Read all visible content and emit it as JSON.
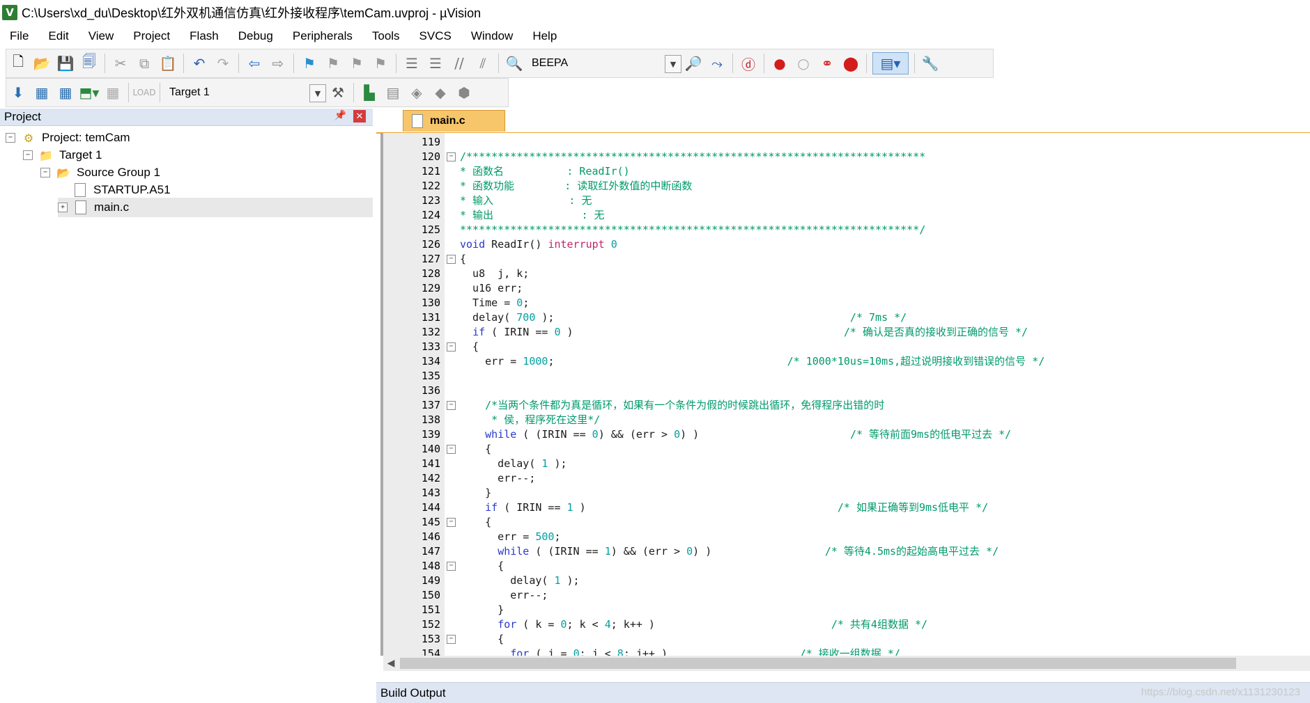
{
  "window": {
    "title": "C:\\Users\\xd_du\\Desktop\\红外双机通信仿真\\红外接收程序\\temCam.uvproj - µVision",
    "app_icon_letter": "V"
  },
  "menu": [
    "File",
    "Edit",
    "View",
    "Project",
    "Flash",
    "Debug",
    "Peripherals",
    "Tools",
    "SVCS",
    "Window",
    "Help"
  ],
  "toolbar": {
    "find_combo_value": "BEEPA",
    "target_combo_value": "Target 1"
  },
  "project_panel": {
    "title": "Project",
    "tree": {
      "project": "Project: temCam",
      "target": "Target 1",
      "group": "Source Group 1",
      "files": [
        "STARTUP.A51",
        "main.c"
      ]
    }
  },
  "editor": {
    "active_tab": "main.c",
    "lines": [
      {
        "n": "119",
        "fold": "",
        "segs": []
      },
      {
        "n": "120",
        "fold": "⊟",
        "segs": [
          {
            "t": "/*************************************************************************",
            "c": "c-comment"
          }
        ]
      },
      {
        "n": "121",
        "fold": "",
        "segs": [
          {
            "t": "* 函数名          : ReadIr()",
            "c": "c-comment"
          }
        ]
      },
      {
        "n": "122",
        "fold": "",
        "segs": [
          {
            "t": "* 函数功能        : 读取红外数值的中断函数",
            "c": "c-comment"
          }
        ]
      },
      {
        "n": "123",
        "fold": "",
        "segs": [
          {
            "t": "* 输入            : 无",
            "c": "c-comment"
          }
        ]
      },
      {
        "n": "124",
        "fold": "",
        "segs": [
          {
            "t": "* 输出              : 无",
            "c": "c-comment"
          }
        ]
      },
      {
        "n": "125",
        "fold": "",
        "segs": [
          {
            "t": "*************************************************************************/",
            "c": "c-comment"
          }
        ]
      },
      {
        "n": "126",
        "fold": "",
        "segs": [
          {
            "t": "void ",
            "c": "c-kw"
          },
          {
            "t": "ReadIr() ",
            "c": "c-plain"
          },
          {
            "t": "interrupt ",
            "c": "c-pink"
          },
          {
            "t": "0",
            "c": "c-num"
          }
        ]
      },
      {
        "n": "127",
        "fold": "⊟",
        "segs": [
          {
            "t": "{",
            "c": "c-plain"
          }
        ]
      },
      {
        "n": "128",
        "fold": "",
        "segs": [
          {
            "t": "  u8  j, k;",
            "c": "c-plain"
          }
        ]
      },
      {
        "n": "129",
        "fold": "",
        "segs": [
          {
            "t": "  u16 err;",
            "c": "c-plain"
          }
        ]
      },
      {
        "n": "130",
        "fold": "",
        "segs": [
          {
            "t": "  Time = ",
            "c": "c-plain"
          },
          {
            "t": "0",
            "c": "c-num"
          },
          {
            "t": ";",
            "c": "c-plain"
          }
        ]
      },
      {
        "n": "131",
        "fold": "",
        "segs": [
          {
            "t": "  delay( ",
            "c": "c-plain"
          },
          {
            "t": "700",
            "c": "c-num"
          },
          {
            "t": " );                                               ",
            "c": "c-plain"
          },
          {
            "t": "/* 7ms */",
            "c": "c-comment"
          }
        ]
      },
      {
        "n": "132",
        "fold": "",
        "segs": [
          {
            "t": "  ",
            "c": "c-plain"
          },
          {
            "t": "if",
            "c": "c-kw"
          },
          {
            "t": " ( IRIN == ",
            "c": "c-plain"
          },
          {
            "t": "0",
            "c": "c-num"
          },
          {
            "t": " )                                           ",
            "c": "c-plain"
          },
          {
            "t": "/* 确认是否真的接收到正确的信号 */",
            "c": "c-comment"
          }
        ]
      },
      {
        "n": "133",
        "fold": "⊟",
        "segs": [
          {
            "t": "  {",
            "c": "c-plain"
          }
        ]
      },
      {
        "n": "134",
        "fold": "",
        "segs": [
          {
            "t": "    err = ",
            "c": "c-plain"
          },
          {
            "t": "1000",
            "c": "c-num"
          },
          {
            "t": ";                                     ",
            "c": "c-plain"
          },
          {
            "t": "/* 1000*10us=10ms,超过说明接收到错误的信号 */",
            "c": "c-comment"
          }
        ]
      },
      {
        "n": "135",
        "fold": "",
        "segs": []
      },
      {
        "n": "136",
        "fold": "",
        "segs": []
      },
      {
        "n": "137",
        "fold": "⊟",
        "segs": [
          {
            "t": "    /*当两个条件都为真是循环，如果有一个条件为假的时候跳出循环，免得程序出错的时",
            "c": "c-comment"
          }
        ]
      },
      {
        "n": "138",
        "fold": "",
        "segs": [
          {
            "t": "     * 侯，程序死在这里*/",
            "c": "c-comment"
          }
        ]
      },
      {
        "n": "139",
        "fold": "",
        "segs": [
          {
            "t": "    ",
            "c": "c-plain"
          },
          {
            "t": "while",
            "c": "c-kw"
          },
          {
            "t": " ( (IRIN == ",
            "c": "c-plain"
          },
          {
            "t": "0",
            "c": "c-num"
          },
          {
            "t": ") && (err > ",
            "c": "c-plain"
          },
          {
            "t": "0",
            "c": "c-num"
          },
          {
            "t": ") )                        ",
            "c": "c-plain"
          },
          {
            "t": "/* 等待前面9ms的低电平过去 */",
            "c": "c-comment"
          }
        ]
      },
      {
        "n": "140",
        "fold": "⊟",
        "segs": [
          {
            "t": "    {",
            "c": "c-plain"
          }
        ]
      },
      {
        "n": "141",
        "fold": "",
        "segs": [
          {
            "t": "      delay( ",
            "c": "c-plain"
          },
          {
            "t": "1",
            "c": "c-num"
          },
          {
            "t": " );",
            "c": "c-plain"
          }
        ]
      },
      {
        "n": "142",
        "fold": "",
        "segs": [
          {
            "t": "      err--;",
            "c": "c-plain"
          }
        ]
      },
      {
        "n": "143",
        "fold": "",
        "segs": [
          {
            "t": "    }",
            "c": "c-plain"
          }
        ]
      },
      {
        "n": "144",
        "fold": "",
        "segs": [
          {
            "t": "    ",
            "c": "c-plain"
          },
          {
            "t": "if",
            "c": "c-kw"
          },
          {
            "t": " ( IRIN == ",
            "c": "c-plain"
          },
          {
            "t": "1",
            "c": "c-num"
          },
          {
            "t": " )                                        ",
            "c": "c-plain"
          },
          {
            "t": "/* 如果正确等到9ms低电平 */",
            "c": "c-comment"
          }
        ]
      },
      {
        "n": "145",
        "fold": "⊟",
        "segs": [
          {
            "t": "    {",
            "c": "c-plain"
          }
        ]
      },
      {
        "n": "146",
        "fold": "",
        "segs": [
          {
            "t": "      err = ",
            "c": "c-plain"
          },
          {
            "t": "500",
            "c": "c-num"
          },
          {
            "t": ";",
            "c": "c-plain"
          }
        ]
      },
      {
        "n": "147",
        "fold": "",
        "segs": [
          {
            "t": "      ",
            "c": "c-plain"
          },
          {
            "t": "while",
            "c": "c-kw"
          },
          {
            "t": " ( (IRIN == ",
            "c": "c-plain"
          },
          {
            "t": "1",
            "c": "c-num"
          },
          {
            "t": ") && (err > ",
            "c": "c-plain"
          },
          {
            "t": "0",
            "c": "c-num"
          },
          {
            "t": ") )                  ",
            "c": "c-plain"
          },
          {
            "t": "/* 等待4.5ms的起始高电平过去 */",
            "c": "c-comment"
          }
        ]
      },
      {
        "n": "148",
        "fold": "⊟",
        "segs": [
          {
            "t": "      {",
            "c": "c-plain"
          }
        ]
      },
      {
        "n": "149",
        "fold": "",
        "segs": [
          {
            "t": "        delay( ",
            "c": "c-plain"
          },
          {
            "t": "1",
            "c": "c-num"
          },
          {
            "t": " );",
            "c": "c-plain"
          }
        ]
      },
      {
        "n": "150",
        "fold": "",
        "segs": [
          {
            "t": "        err--;",
            "c": "c-plain"
          }
        ]
      },
      {
        "n": "151",
        "fold": "",
        "segs": [
          {
            "t": "      }",
            "c": "c-plain"
          }
        ]
      },
      {
        "n": "152",
        "fold": "",
        "segs": [
          {
            "t": "      ",
            "c": "c-plain"
          },
          {
            "t": "for",
            "c": "c-kw"
          },
          {
            "t": " ( k = ",
            "c": "c-plain"
          },
          {
            "t": "0",
            "c": "c-num"
          },
          {
            "t": "; k < ",
            "c": "c-plain"
          },
          {
            "t": "4",
            "c": "c-num"
          },
          {
            "t": "; k++ )                            ",
            "c": "c-plain"
          },
          {
            "t": "/* 共有4组数据 */",
            "c": "c-comment"
          }
        ]
      },
      {
        "n": "153",
        "fold": "⊟",
        "segs": [
          {
            "t": "      {",
            "c": "c-plain"
          }
        ]
      },
      {
        "n": "154",
        "fold": "",
        "segs": [
          {
            "t": "        ",
            "c": "c-plain"
          },
          {
            "t": "for",
            "c": "c-kw"
          },
          {
            "t": " ( j = ",
            "c": "c-plain"
          },
          {
            "t": "0",
            "c": "c-num"
          },
          {
            "t": "; j < ",
            "c": "c-plain"
          },
          {
            "t": "8",
            "c": "c-num"
          },
          {
            "t": "; j++ )                     ",
            "c": "c-plain"
          },
          {
            "t": "/* 接收一组数据 */",
            "c": "c-comment"
          }
        ]
      }
    ]
  },
  "build_output": {
    "title": "Build Output"
  },
  "watermark": "https://blog.csdn.net/x1131230123"
}
